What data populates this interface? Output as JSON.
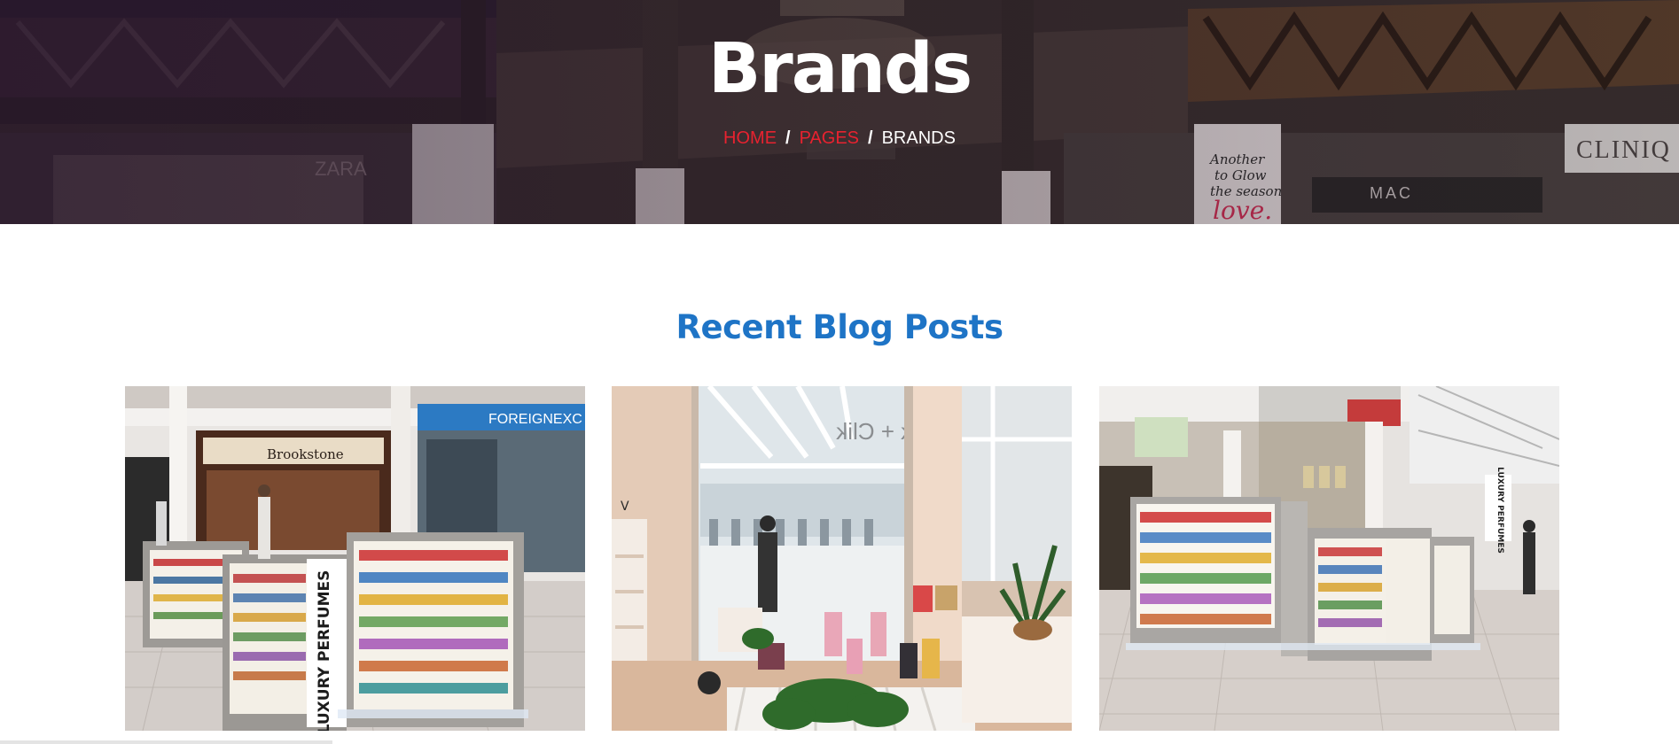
{
  "hero": {
    "title": "Brands",
    "breadcrumb": {
      "home": "HOME",
      "pages": "PAGES",
      "current": "BRANDS",
      "separator": "/"
    },
    "background_signs": [
      "ZARA",
      "MAC",
      "CLINIQ",
      "Another reason to Glow the season love."
    ]
  },
  "colors": {
    "link_red": "#e8222f",
    "section_title_blue": "#1e74c6",
    "hero_text": "#ffffff"
  },
  "section": {
    "title": "Recent Blog Posts"
  },
  "posts": [
    {
      "image_signs": [
        "Brookstone",
        "FOREIGNEXC",
        "LUXURY PERFUMES"
      ]
    },
    {
      "image_signs": [
        "Brik + Clik"
      ]
    },
    {
      "image_signs": [
        "LUXURY PERFUMES"
      ]
    }
  ]
}
